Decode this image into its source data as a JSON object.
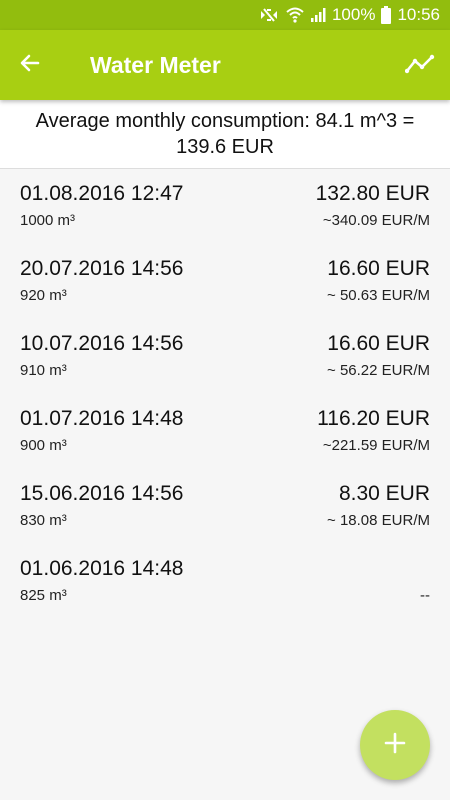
{
  "status_bar": {
    "battery": "100%",
    "time": "10:56",
    "icons": [
      "mute-icon",
      "wifi-icon",
      "signal-icon",
      "battery-icon"
    ]
  },
  "app_bar": {
    "title": "Water Meter",
    "back_icon": "arrow-left-icon",
    "chart_icon": "trend-chart-icon"
  },
  "summary": {
    "text": "Average monthly consumption: 84.1 m^3 = 139.6 EUR"
  },
  "readings": [
    {
      "date": "01.08.2016 12:47",
      "reading": "1000 m³",
      "cost": "132.80 EUR",
      "rate": "~340.09 EUR/M"
    },
    {
      "date": "20.07.2016 14:56",
      "reading": "920 m³",
      "cost": "16.60 EUR",
      "rate": "~ 50.63 EUR/M"
    },
    {
      "date": "10.07.2016 14:56",
      "reading": "910 m³",
      "cost": "16.60 EUR",
      "rate": "~ 56.22 EUR/M"
    },
    {
      "date": "01.07.2016 14:48",
      "reading": "900 m³",
      "cost": "116.20 EUR",
      "rate": "~221.59 EUR/M"
    },
    {
      "date": "15.06.2016 14:56",
      "reading": "830 m³",
      "cost": "8.30 EUR",
      "rate": "~ 18.08 EUR/M"
    },
    {
      "date": "01.06.2016 14:48",
      "reading": "825 m³",
      "cost": "",
      "rate": "--"
    }
  ],
  "fab": {
    "icon": "plus-icon"
  },
  "colors": {
    "accent": "#a8cf12",
    "status_bar": "#92bd0e",
    "fab": "#c3e060"
  }
}
